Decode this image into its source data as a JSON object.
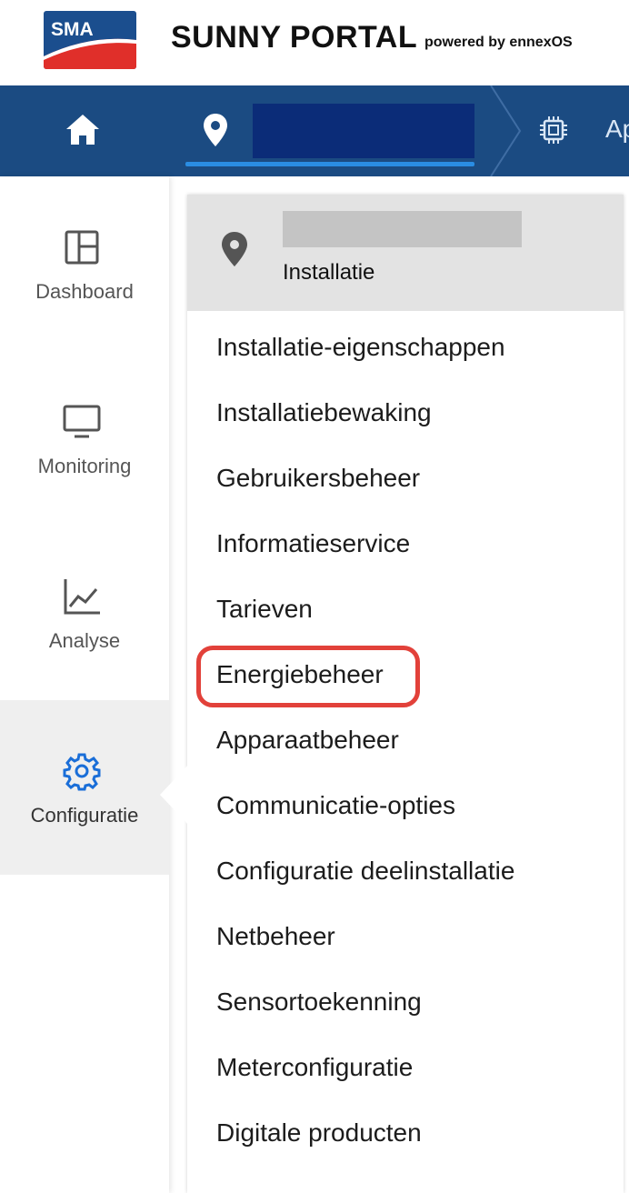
{
  "header": {
    "logo_text": "SMA",
    "title": "SUNNY PORTAL",
    "subtitle": "powered by ennexOS"
  },
  "topnav": {
    "home_icon": "home-icon",
    "location_icon": "location-pin-icon",
    "device_icon": "device-chip-icon",
    "device_label": "Ap",
    "colors": {
      "bar": "#1b4b82",
      "active_underline": "#2a8de3",
      "redacted_field": "#0b2c78"
    }
  },
  "sidebar": {
    "items": [
      {
        "label": "Dashboard",
        "icon": "dashboard-icon",
        "active": false
      },
      {
        "label": "Monitoring",
        "icon": "monitor-icon",
        "active": false
      },
      {
        "label": "Analyse",
        "icon": "chart-icon",
        "active": false
      },
      {
        "label": "Configuratie",
        "icon": "gear-icon",
        "active": true
      }
    ],
    "active_color": "#1a6ed8"
  },
  "flyout": {
    "header_icon": "location-pin-icon",
    "header_label": "Installatie",
    "items": [
      "Installatie-eigenschappen",
      "Installatiebewaking",
      "Gebruikersbeheer",
      "Informatieservice",
      "Tarieven",
      "Energiebeheer",
      "Apparaatbeheer",
      "Communicatie-opties",
      "Configuratie deelinstallatie",
      "Netbeheer",
      "Sensortoekenning",
      "Meterconfiguratie",
      "Digitale producten"
    ],
    "highlighted_item": "Energiebeheer",
    "highlight_color": "#e2413a"
  }
}
